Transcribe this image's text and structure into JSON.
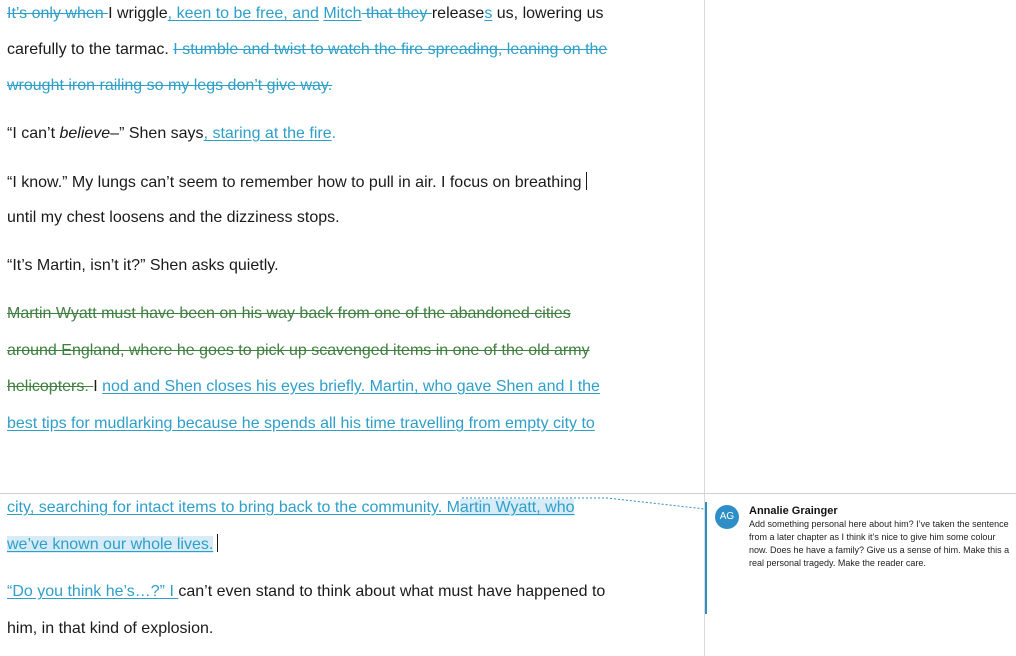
{
  "doc": {
    "l1": {
      "a": "It’s only when ",
      "b": "I wriggle",
      "c": ", keen to be free, and",
      "d": " ",
      "e": "Mitch",
      "f": " that they ",
      "g": "release",
      "h": "s",
      "i": " us, lowering us"
    },
    "l2": {
      "a": "carefully to the tarmac. ",
      "b": "I stumble and twist to watch the fire spreading, leaning on the"
    },
    "l3": {
      "a": "wrought iron railing so my legs don’t give way."
    },
    "l4": {
      "a": "“I can’t ",
      "b": "believe",
      "c": "–” Shen says",
      "d": ", staring at the fire",
      "e": "."
    },
    "l5": {
      "a": "“I know.” My lungs can’t seem to remember how to pull in air. I focus on breathing"
    },
    "l6": {
      "a": "until my chest loosens and the dizziness stops."
    },
    "l7": {
      "a": "“It’s Martin, isn’t it?” Shen asks quietly."
    },
    "l8": {
      "a": "Martin Wyatt must have been on his way back from one of the abandoned cities"
    },
    "l9": {
      "a": "around England, where he goes to pick up scavenged items in one of the old army"
    },
    "l10": {
      "a": "helicopters. ",
      "b": "I ",
      "c": "nod",
      "d": " and Shen closes his eyes briefly. Martin, who gave Shen and I the"
    },
    "l11": {
      "a": "best tips for mudlarking because he spends all his time travelling from empty city to"
    },
    "l12": {
      "a": "city, searching for intact items to bring back to the community. M",
      "b": "artin Wyatt, who"
    },
    "l13": {
      "a": "we’ve known our whole lives."
    },
    "l14": {
      "a": "“Do you think he’s…?” I ",
      "b": "can’t even stand to think about what must have happened to"
    },
    "l15": {
      "a": "him, in that kind of explosion."
    }
  },
  "comment": {
    "initials": "AG",
    "author": "Annalie Grainger",
    "text": "Add something personal here about him? I’ve taken the sentence from a later chapter as I think it’s nice to give him some colour now. Does he have a family? Give us a sense of him. Make this a real personal tragedy. Make the reader care."
  },
  "colors": {
    "insertion": "#2e9fc9",
    "deletion_green": "#3f7f3f",
    "comment_accent": "#2e8fc6"
  }
}
